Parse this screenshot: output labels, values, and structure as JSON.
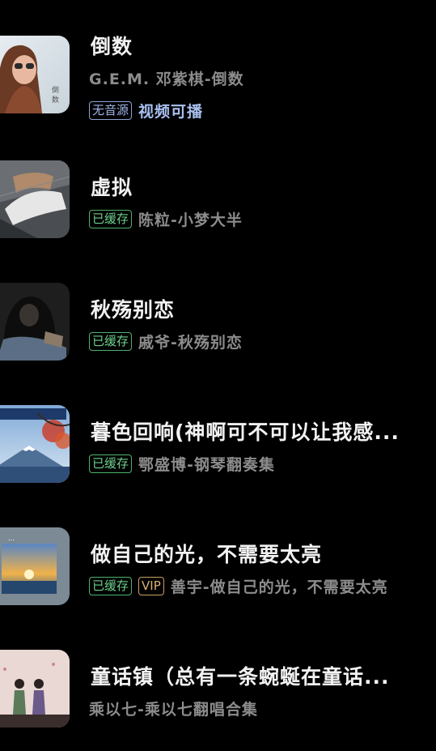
{
  "songs": [
    {
      "title": "倒数",
      "artist_line": "G.E.M. 邓紫棋-倒数",
      "badge": "无音源",
      "extra_link": "视频可播",
      "cover_icon": "portrait-woman-sunglasses"
    },
    {
      "title": "虚拟",
      "badge": "已缓存",
      "artist_line": "陈粒-小梦大半",
      "cover_icon": "hands-illustration"
    },
    {
      "title": "秋殇别恋",
      "badge": "已缓存",
      "artist_line": "戚爷-秋殇别恋",
      "cover_icon": "hooded-figure"
    },
    {
      "title": "暮色回响(神啊可不可以让我感...",
      "badge": "已缓存",
      "artist_line": "鄂盛博-钢琴翻奏集",
      "cover_icon": "mount-fuji-landscape"
    },
    {
      "title": "做自己的光，不需要太亮",
      "badge": "已缓存",
      "vip_badge": "VIP",
      "artist_line": "善宇-做自己的光，不需要太亮",
      "cover_icon": "sunset-painting"
    },
    {
      "title": "童话镇（总有一条蜿蜒在童话...",
      "artist_line": "乘以七-乘以七翻唱合集",
      "cover_icon": "couple-illustration"
    }
  ],
  "colors": {
    "background": "#000000",
    "cached_badge": "#6ed08c",
    "no_source_badge": "#9fb3e6",
    "vip_badge": "#d9b27a",
    "video_link": "#a9c0f0"
  }
}
